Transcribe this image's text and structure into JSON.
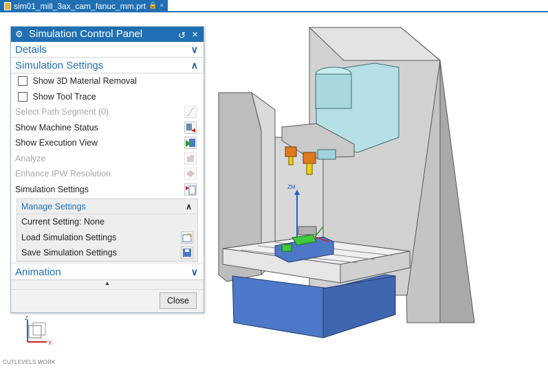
{
  "tab": {
    "title": "sim01_mill_3ax_cam_fanuc_mm.prt",
    "lock": "🔒",
    "close": "×"
  },
  "panel": {
    "title": "Simulation Control Panel",
    "sections": {
      "details": {
        "label": "Details",
        "state": "collapsed"
      },
      "simulation_settings": {
        "label": "Simulation Settings",
        "state": "expanded",
        "checkboxes": [
          {
            "label": "Show 3D Material Removal",
            "checked": false
          },
          {
            "label": "Show Tool Trace",
            "checked": false
          }
        ],
        "rows": [
          {
            "label": "Select Path Segment (0)",
            "enabled": false,
            "icon": "path-segment-icon"
          },
          {
            "label": "Show Machine Status",
            "enabled": true,
            "icon": "machine-status-icon"
          },
          {
            "label": "Show Execution View",
            "enabled": true,
            "icon": "execution-view-icon"
          },
          {
            "label": "Analyze",
            "enabled": false,
            "icon": "analyze-icon"
          },
          {
            "label": "Enhance IPW Resolution",
            "enabled": false,
            "icon": "ipw-resolution-icon"
          },
          {
            "label": "Simulation Settings",
            "enabled": true,
            "icon": "simulation-settings-icon"
          }
        ],
        "manage": {
          "label": "Manage Settings",
          "current": "Current Setting: None",
          "load": "Load Simulation Settings",
          "save": "Save Simulation Settings"
        }
      },
      "animation": {
        "label": "Animation",
        "state": "collapsed"
      }
    },
    "close_label": "Close"
  },
  "viewport": {
    "triad": {
      "z": "Z",
      "x": "X"
    },
    "axis_label": "ZM",
    "status_text": "CUTLEVELS WORK"
  },
  "colors": {
    "accent": "#1f6fb2",
    "spindle_head": "#b5e0e6",
    "machine_body": "#d3d3d3",
    "base": "#4d78c8",
    "fixture_green": "#3fc93f",
    "tool_orange": "#e07a1f"
  }
}
